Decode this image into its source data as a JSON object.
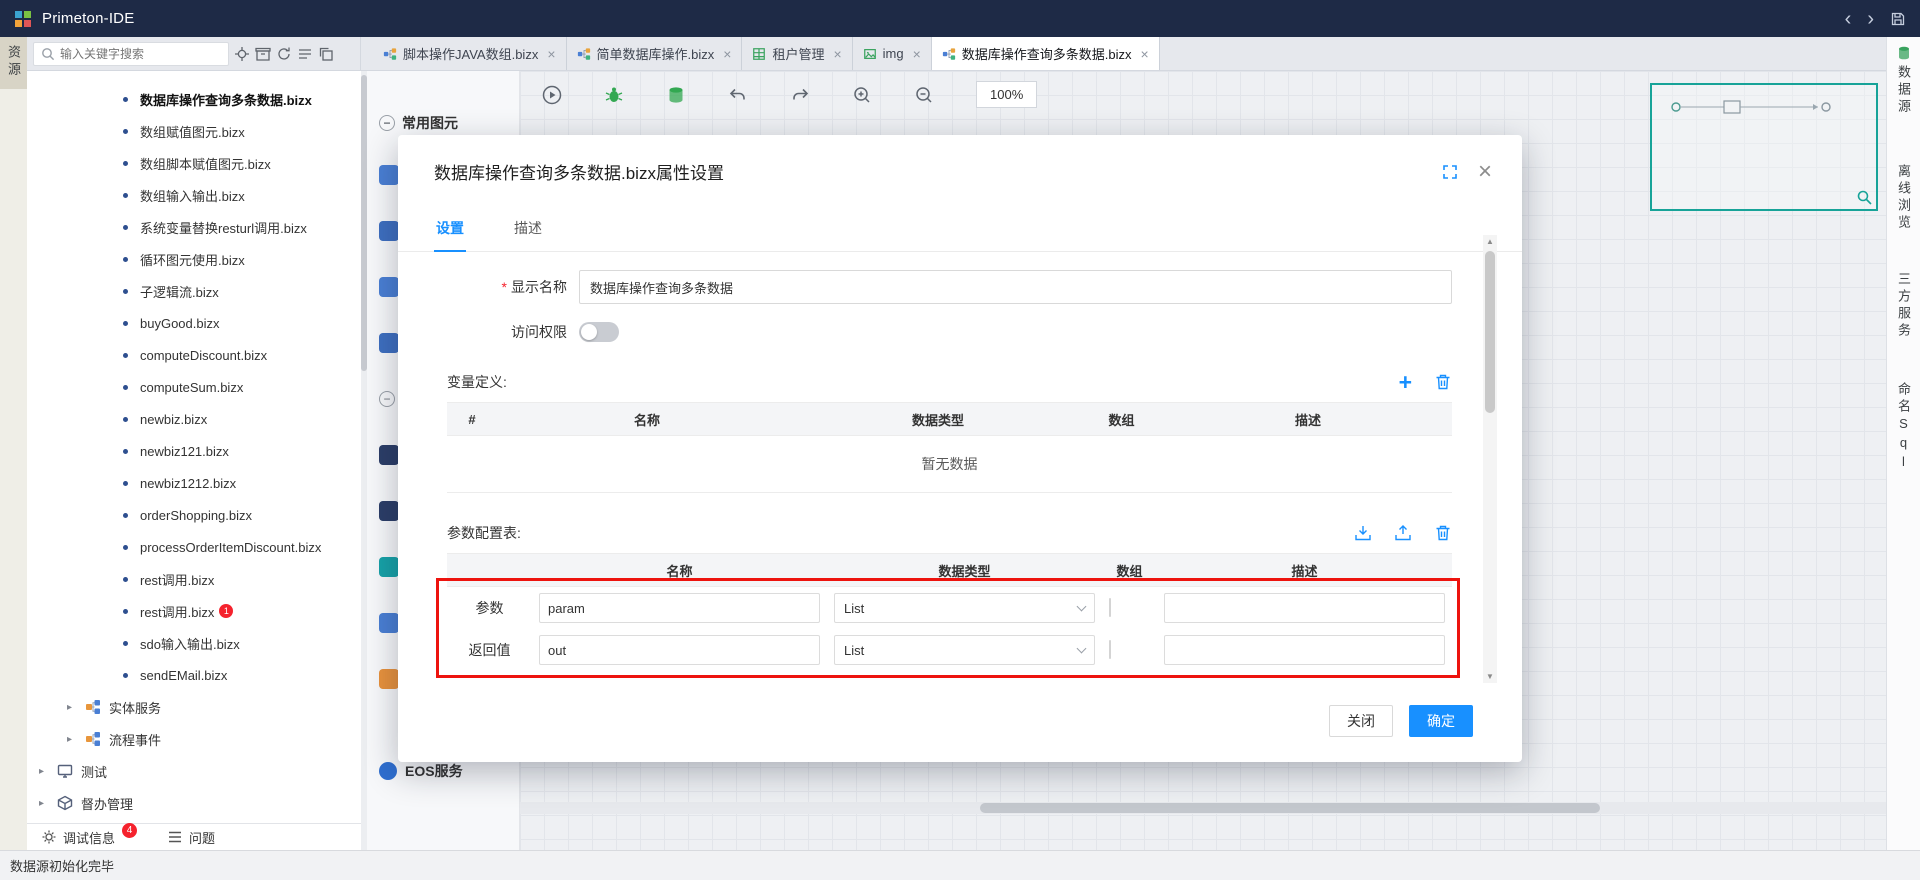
{
  "titlebar": {
    "app_title": "Primeton-IDE"
  },
  "glyphs": {
    "close": "×",
    "caret": "▸",
    "collapse": "−",
    "plus": "+",
    "chevron_left": "‹",
    "chevron_right": "›",
    "up": "▲",
    "down": "▼"
  },
  "left_rail": {
    "label": "资源"
  },
  "sidebar": {
    "search": {
      "placeholder": "输入关键字搜索"
    },
    "tree": [
      {
        "label": "数据库操作查询多条数据.bizx"
      },
      {
        "label": "数组赋值图元.bizx"
      },
      {
        "label": "数组脚本赋值图元.bizx"
      },
      {
        "label": "数组输入输出.bizx"
      },
      {
        "label": "系统变量替换resturl调用.bizx"
      },
      {
        "label": "循环图元使用.bizx"
      },
      {
        "label": "子逻辑流.bizx"
      },
      {
        "label": "buyGood.bizx"
      },
      {
        "label": "computeDiscount.bizx"
      },
      {
        "label": "computeSum.bizx"
      },
      {
        "label": "newbiz.bizx"
      },
      {
        "label": "newbiz121.bizx"
      },
      {
        "label": "newbiz1212.bizx"
      },
      {
        "label": "orderShopping.bizx"
      },
      {
        "label": "processOrderItemDiscount.bizx"
      },
      {
        "label": "rest调用.bizx"
      },
      {
        "label": "rest调用.bizx",
        "badge": "1"
      },
      {
        "label": "sdo输入输出.bizx"
      },
      {
        "label": "sendEMail.bizx"
      },
      {
        "label": "实体服务"
      },
      {
        "label": "流程事件"
      },
      {
        "label": "测试"
      },
      {
        "label": "督办管理"
      }
    ],
    "bottom_tabs": [
      {
        "label": "调试信息",
        "badge": "4"
      },
      {
        "label": "问题"
      }
    ]
  },
  "editor_tabs": [
    {
      "label": "脚本操作JAVA数组.bizx"
    },
    {
      "label": "简单数据库操作.bizx"
    },
    {
      "label": "租户管理"
    },
    {
      "label": "img"
    },
    {
      "label": "数据库操作查询多条数据.bizx"
    }
  ],
  "toolbar": {
    "zoom_level": "100%"
  },
  "palette": {
    "section_common": "常用图元",
    "section_eos": "EOS服务"
  },
  "right_rail": {
    "items": [
      {
        "label": "数据源"
      },
      {
        "label": "离线浏览"
      },
      {
        "label": "三方服务"
      },
      {
        "label": "命名Sql"
      }
    ]
  },
  "modal": {
    "title": "数据库操作查询多条数据.bizx属性设置",
    "tabs": [
      {
        "label": "设置"
      },
      {
        "label": "描述"
      }
    ],
    "fields": {
      "display_name_required": "*",
      "display_name_label": "显示名称",
      "display_name_value": "数据库操作查询多条数据",
      "access_label": "访问权限"
    },
    "variables_section": {
      "title": "变量定义:",
      "headers": [
        "#",
        "名称",
        "数据类型",
        "数组",
        "描述"
      ],
      "empty_text": "暂无数据"
    },
    "params_section": {
      "title": "参数配置表:",
      "headers": [
        "名称",
        "数据类型",
        "数组",
        "描述"
      ],
      "rows": [
        {
          "label": "参数",
          "name": "param",
          "type": "List"
        },
        {
          "label": "返回值",
          "name": "out",
          "type": "List"
        }
      ]
    },
    "footer": {
      "close_label": "关闭",
      "ok_label": "确定"
    }
  },
  "statusbar": {
    "message": "数据源初始化完毕"
  }
}
